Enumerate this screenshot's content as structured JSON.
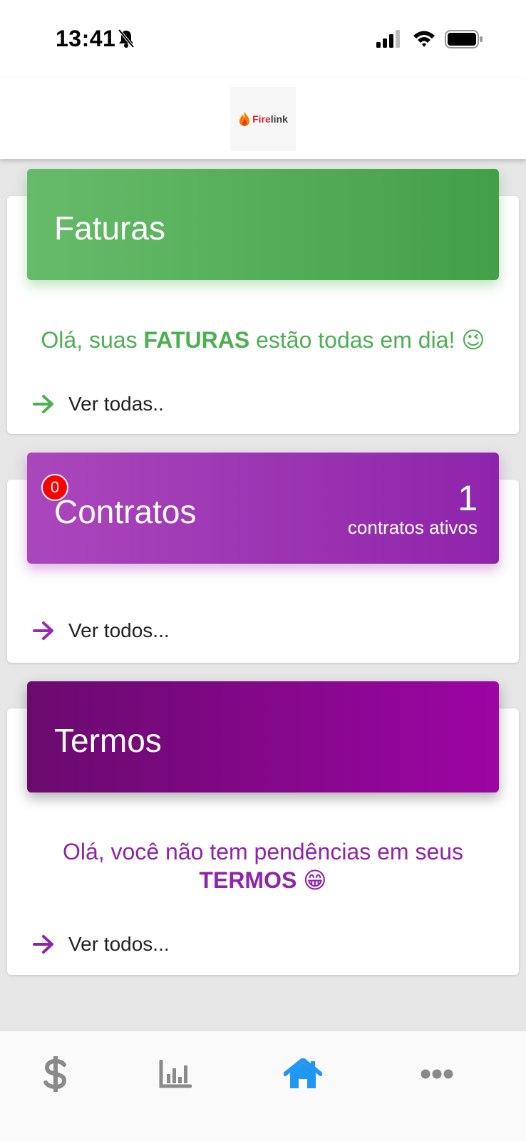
{
  "status_bar": {
    "time": "13:41",
    "icons": [
      "bell-slash-icon",
      "signal-icon",
      "wifi-icon",
      "battery-icon"
    ]
  },
  "header": {
    "logo_prefix": "Fire",
    "logo_suffix": "link"
  },
  "faturas": {
    "title": "Faturas",
    "message_prefix": "Olá, suas ",
    "message_bold": "FATURAS",
    "message_suffix": " estão todas em dia! 😉",
    "link": "Ver todas..",
    "color": "#4caf50"
  },
  "contratos": {
    "title": "Contratos",
    "badge": "0",
    "count": "1",
    "count_label": "contratos ativos",
    "link": "Ver todos...",
    "color": "#9c27b0"
  },
  "termos": {
    "title": "Termos",
    "message_prefix": "Olá, você não tem pendências em seus",
    "message_bold": "TERMOS",
    "message_emoji": " 😁",
    "link": "Ver todos...",
    "color": "#8e24aa"
  },
  "tab_bar": {
    "tabs": [
      {
        "icon": "dollar-icon",
        "active": false
      },
      {
        "icon": "chart-icon",
        "active": false
      },
      {
        "icon": "home-icon",
        "active": true
      },
      {
        "icon": "more-icon",
        "active": false
      }
    ],
    "active_color": "#2196f3",
    "inactive_color": "#8a8a8a"
  }
}
